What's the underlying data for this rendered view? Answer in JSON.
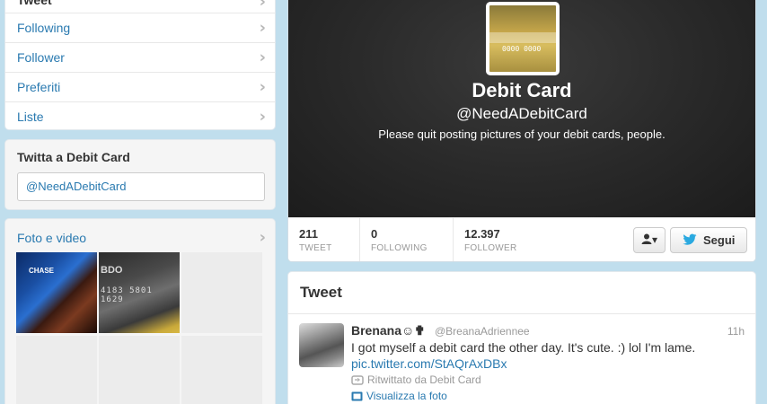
{
  "nav": {
    "items": [
      {
        "label": "Tweet"
      },
      {
        "label": "Following"
      },
      {
        "label": "Follower"
      },
      {
        "label": "Preferiti"
      },
      {
        "label": "Liste"
      }
    ]
  },
  "tweet_to": {
    "title": "Twitta a Debit Card",
    "value": "@NeedADebitCard"
  },
  "media": {
    "title": "Foto e video",
    "thumb1_brand": "CHASE",
    "thumb2_brand": "BDO",
    "thumb2_number": "4183 5801 1629"
  },
  "profile": {
    "name": "Debit Card",
    "handle": "@NeedADebitCard",
    "bio": "Please quit posting pictures of your debit cards, people.",
    "avatar_number": "0000 0000",
    "stats": [
      {
        "num": "211",
        "label": "TWEET"
      },
      {
        "num": "0",
        "label": "FOLLOWING"
      },
      {
        "num": "12.397",
        "label": "FOLLOWER"
      }
    ],
    "follow_label": "Segui",
    "user_menu_label": "▾"
  },
  "tweets": {
    "title": "Tweet",
    "items": [
      {
        "name": "Brenana☺✟",
        "handle": "@BreanaAdriennee",
        "time": "11h",
        "text": "I got myself a debit card the other day. It's cute. :) lol I'm lame.",
        "link": "pic.twitter.com/StAQrAxDBx",
        "retweeted_by": "Ritwittato da Debit Card",
        "view_photo": "Visualizza la foto"
      }
    ]
  },
  "colors": {
    "background": "#c0deed",
    "link": "#2a7ab0",
    "twitter_blue": "#2aa9e0"
  }
}
